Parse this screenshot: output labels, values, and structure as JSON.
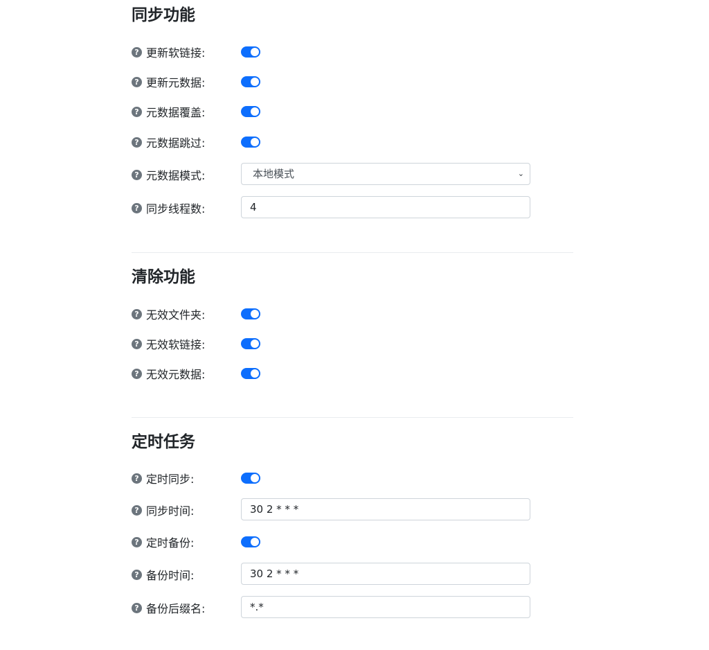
{
  "sections": {
    "sync": {
      "title": "同步功能",
      "update_symlink": {
        "label": "更新软链接:",
        "enabled": true
      },
      "update_metadata": {
        "label": "更新元数据:",
        "enabled": true
      },
      "metadata_overwrite": {
        "label": "元数据覆盖:",
        "enabled": true
      },
      "metadata_skip": {
        "label": "元数据跳过:",
        "enabled": true
      },
      "metadata_mode": {
        "label": "元数据模式:",
        "value": "本地模式"
      },
      "sync_threads": {
        "label": "同步线程数:",
        "value": "4"
      }
    },
    "cleanup": {
      "title": "清除功能",
      "invalid_folder": {
        "label": "无效文件夹:",
        "enabled": true
      },
      "invalid_symlink": {
        "label": "无效软链接:",
        "enabled": true
      },
      "invalid_metadata": {
        "label": "无效元数据:",
        "enabled": true
      }
    },
    "schedule": {
      "title": "定时任务",
      "scheduled_sync": {
        "label": "定时同步:",
        "enabled": true
      },
      "sync_time": {
        "label": "同步时间:",
        "value": "30 2 * * *"
      },
      "scheduled_backup": {
        "label": "定时备份:",
        "enabled": true
      },
      "backup_time": {
        "label": "备份时间:",
        "value": "30 2 * * *"
      },
      "backup_suffix": {
        "label": "备份后缀名:",
        "value": "*.*"
      }
    }
  },
  "help_icon_glyph": "?",
  "select_chevron_glyph": "⌄",
  "colors": {
    "accent": "#0d6efd",
    "help_icon": "#6c757d",
    "border": "#ced4da",
    "text": "#212529"
  }
}
